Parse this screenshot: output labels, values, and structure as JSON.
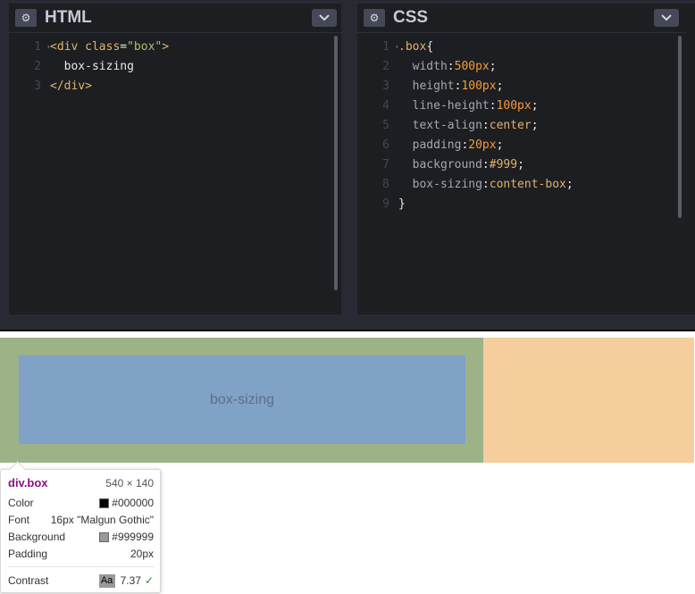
{
  "html_panel": {
    "title": "HTML",
    "lines": [
      {
        "num": "1",
        "fold": true,
        "tokens": [
          {
            "t": "<div ",
            "c": "c-tag"
          },
          {
            "t": "class",
            "c": "c-attr"
          },
          {
            "t": "=",
            "c": "c-plain"
          },
          {
            "t": "\"box\"",
            "c": "c-str"
          },
          {
            "t": ">",
            "c": "c-tag"
          }
        ]
      },
      {
        "num": "2",
        "fold": false,
        "tokens": [
          {
            "t": "  box-sizing",
            "c": "c-plain"
          }
        ]
      },
      {
        "num": "3",
        "fold": false,
        "tokens": [
          {
            "t": "</div>",
            "c": "c-tag"
          }
        ]
      }
    ]
  },
  "css_panel": {
    "title": "CSS",
    "lines": [
      {
        "num": "1",
        "fold": true,
        "tokens": [
          {
            "t": ".box",
            "c": "c-tag"
          },
          {
            "t": "{",
            "c": "c-punc"
          }
        ]
      },
      {
        "num": "2",
        "fold": false,
        "tokens": [
          {
            "t": "  width",
            "c": "c-prop"
          },
          {
            "t": ":",
            "c": "c-punc"
          },
          {
            "t": "500px",
            "c": "c-num"
          },
          {
            "t": ";",
            "c": "c-punc"
          }
        ]
      },
      {
        "num": "3",
        "fold": false,
        "tokens": [
          {
            "t": "  height",
            "c": "c-prop"
          },
          {
            "t": ":",
            "c": "c-punc"
          },
          {
            "t": "100px",
            "c": "c-num"
          },
          {
            "t": ";",
            "c": "c-punc"
          }
        ]
      },
      {
        "num": "4",
        "fold": false,
        "tokens": [
          {
            "t": "  line-height",
            "c": "c-prop"
          },
          {
            "t": ":",
            "c": "c-punc"
          },
          {
            "t": "100px",
            "c": "c-num"
          },
          {
            "t": ";",
            "c": "c-punc"
          }
        ]
      },
      {
        "num": "5",
        "fold": false,
        "tokens": [
          {
            "t": "  text-align",
            "c": "c-prop"
          },
          {
            "t": ":",
            "c": "c-punc"
          },
          {
            "t": "center",
            "c": "c-val"
          },
          {
            "t": ";",
            "c": "c-punc"
          }
        ]
      },
      {
        "num": "6",
        "fold": false,
        "tokens": [
          {
            "t": "  padding",
            "c": "c-prop"
          },
          {
            "t": ":",
            "c": "c-punc"
          },
          {
            "t": "20px",
            "c": "c-num"
          },
          {
            "t": ";",
            "c": "c-punc"
          }
        ]
      },
      {
        "num": "7",
        "fold": false,
        "tokens": [
          {
            "t": "  background",
            "c": "c-prop"
          },
          {
            "t": ":",
            "c": "c-punc"
          },
          {
            "t": "#999",
            "c": "c-val"
          },
          {
            "t": ";",
            "c": "c-punc"
          }
        ]
      },
      {
        "num": "8",
        "fold": false,
        "tokens": [
          {
            "t": "  box-sizing",
            "c": "c-prop"
          },
          {
            "t": ":",
            "c": "c-punc"
          },
          {
            "t": "content-box",
            "c": "c-val"
          },
          {
            "t": ";",
            "c": "c-punc"
          }
        ]
      },
      {
        "num": "9",
        "fold": false,
        "tokens": [
          {
            "t": "}",
            "c": "c-punc"
          }
        ]
      }
    ]
  },
  "preview": {
    "box_text": "box-sizing"
  },
  "inspector_tooltip": {
    "selector": "div.box",
    "dimensions": "540 × 140",
    "color_label": "Color",
    "color_value": "#000000",
    "font_label": "Font",
    "font_value": "16px \"Malgun Gothic\"",
    "background_label": "Background",
    "background_value": "#999999",
    "padding_label": "Padding",
    "padding_value": "20px",
    "contrast_label": "Contrast",
    "contrast_sample": "Aa",
    "contrast_value": "7.37"
  },
  "colors": {
    "editor_bg": "#1d1e22",
    "content_box": "#7fa2c6",
    "padding_box": "#9db387",
    "margin_box": "#f6cd9d"
  }
}
